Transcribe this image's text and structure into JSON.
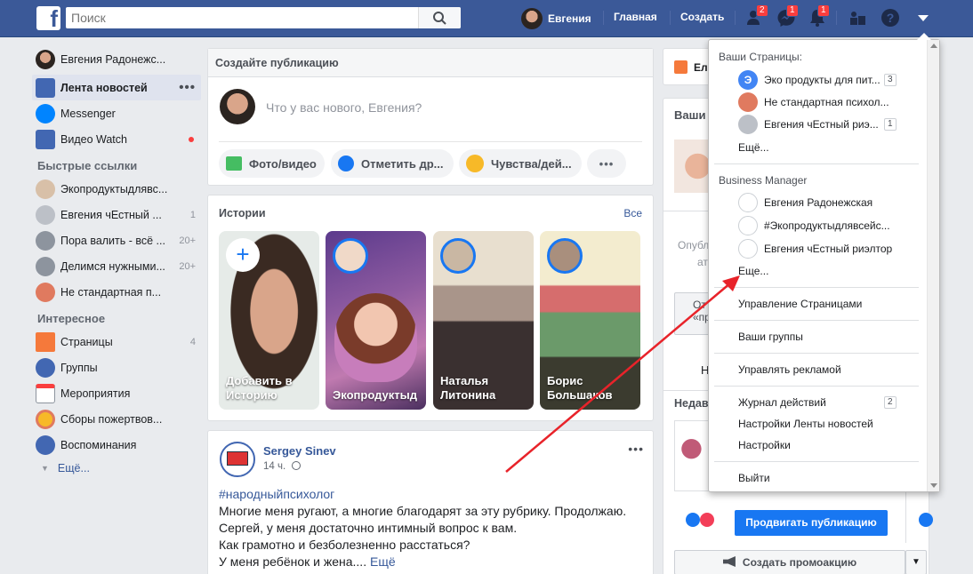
{
  "topbar": {
    "logo": "f",
    "search_placeholder": "Поиск",
    "user_name": "Евгения",
    "home": "Главная",
    "create": "Создать",
    "friends_badge": "2",
    "messages_badge": "1",
    "notifications_badge": "1"
  },
  "left": {
    "profile": "Евгения Радонежс...",
    "nav": [
      {
        "label": "Лента новостей"
      },
      {
        "label": "Messenger"
      },
      {
        "label": "Видео Watch"
      }
    ],
    "quick_title": "Быстрые ссылки",
    "quick": [
      {
        "label": "Экопродуктыдлявс...",
        "count": ""
      },
      {
        "label": "Евгения чЕстный ...",
        "count": "1"
      },
      {
        "label": "Пора валить - всё ...",
        "count": "20+"
      },
      {
        "label": "Делимся нужными...",
        "count": "20+"
      },
      {
        "label": "Не стандартная п...",
        "count": ""
      }
    ],
    "explore_title": "Интересное",
    "explore": [
      {
        "label": "Страницы",
        "count": "4"
      },
      {
        "label": "Группы",
        "count": ""
      },
      {
        "label": "Мероприятия",
        "count": ""
      },
      {
        "label": "Сборы пожертвов...",
        "count": ""
      },
      {
        "label": "Воспоминания",
        "count": ""
      }
    ],
    "more": "Ещё..."
  },
  "composer": {
    "title": "Создайте публикацию",
    "placeholder": "Что у вас нового, Евгения?",
    "photo": "Фото/видео",
    "tag": "Отметить др...",
    "feeling": "Чувства/дей..."
  },
  "stories": {
    "title": "Истории",
    "all": "Все",
    "items": [
      {
        "label": "Добавить в Историю"
      },
      {
        "label": "Экопродуктыд"
      },
      {
        "label": "Наталья Литонина"
      },
      {
        "label": "Борис Большаков"
      }
    ]
  },
  "post": {
    "author": "Sergey Sinev",
    "time": "14 ч.",
    "hashtag": "#народныйпсихолог",
    "lines": [
      "Многие меня ругают, а многие благодарят за эту рубрику. Продолжаю.",
      "Сергей, у меня достаточно интимный вопрос к вам.",
      "Как грамотно и безболезненно расстаться?",
      "У меня ребёнок и жена...."
    ],
    "more": "Ещё"
  },
  "right": {
    "gift": "Ел",
    "pages_title": "Ваши",
    "publish_text": "Опубл",
    "publish_text2": "ат",
    "tab1": "От",
    "tab1b": "«пра",
    "n_text": "Н",
    "recent": "Недав",
    "promote": "Продвигать публикацию",
    "promo": "Создать промоакцию"
  },
  "dropdown": {
    "pages_title": "Ваши Страницы:",
    "pages": [
      {
        "label": "Эко продукты для пит...",
        "count": "3",
        "icon": "Э"
      },
      {
        "label": "Не стандартная психол...",
        "count": ""
      },
      {
        "label": "Евгения чЕстный риэ...",
        "count": "1"
      }
    ],
    "pages_more": "Ещё...",
    "bm_title": "Business Manager",
    "bm": [
      {
        "label": "Евгения Радонежская"
      },
      {
        "label": "#Экопродуктыдлявсейс..."
      },
      {
        "label": "Евгения чЕстный риэлтор"
      }
    ],
    "bm_more": "Еще...",
    "manage_pages": "Управление Страницами",
    "groups": "Ваши группы",
    "ads": "Управлять рекламой",
    "activity": "Журнал действий",
    "activity_count": "2",
    "feed_settings": "Настройки Ленты новостей",
    "settings": "Настройки",
    "logout": "Выйти"
  },
  "colors": {
    "brand": "#3b5998",
    "accent": "#1877f2",
    "badge": "#fa3e3e",
    "arrow": "#e8232a"
  }
}
